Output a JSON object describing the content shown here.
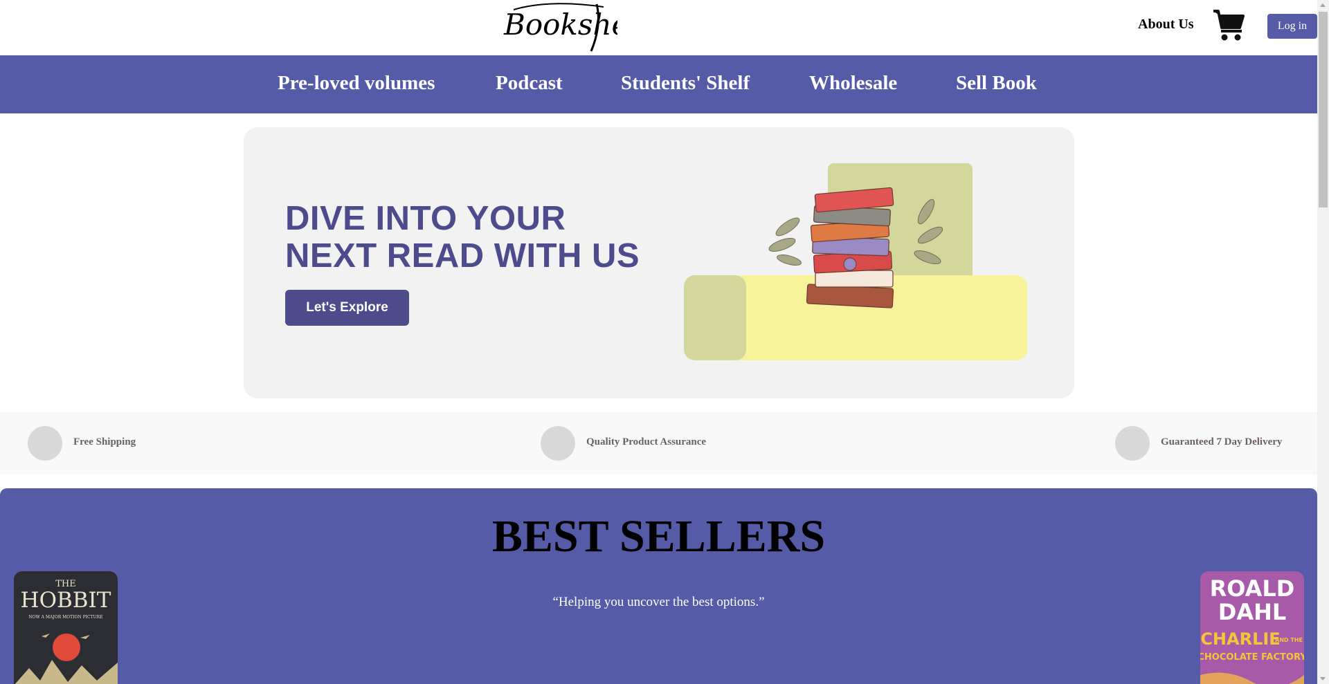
{
  "header": {
    "logo_text": "Bookshelf",
    "about_label": "About Us",
    "cart_icon": "shopping-cart-icon",
    "login_label": "Log in"
  },
  "nav": {
    "items": [
      {
        "label": "Pre-loved volumes"
      },
      {
        "label": "Podcast"
      },
      {
        "label": "Students' Shelf"
      },
      {
        "label": "Wholesale"
      },
      {
        "label": "Sell Book"
      }
    ]
  },
  "hero": {
    "headline_line1": "DIVE INTO YOUR",
    "headline_line2": "NEXT READ WITH US",
    "cta_label": "Let's Explore"
  },
  "features": [
    {
      "label": "Free Shipping"
    },
    {
      "label": "Quality Product Assurance"
    },
    {
      "label": "Guaranteed 7 Day Delivery"
    }
  ],
  "bestsellers": {
    "title": "BEST SELLERS",
    "quote": "“Helping you uncover the best options.”",
    "books": [
      {
        "cover_text_1": "THE",
        "cover_text_2": "HOBBIT",
        "cover_text_3": "NOW A MAJOR MOTION PICTURE"
      },
      {
        "cover_text_1": "ROALD",
        "cover_text_2": "DAHL",
        "cover_text_3": "CHARLIE",
        "cover_text_4": "AND THE",
        "cover_text_5": "CHOCOLATE FACTORY"
      }
    ]
  },
  "colors": {
    "brand": "#565ba8",
    "headline": "#4e4b8c",
    "hero_bg": "#f2f2f2",
    "yellow": "#f8f29b",
    "sage": "#d3d79b"
  }
}
